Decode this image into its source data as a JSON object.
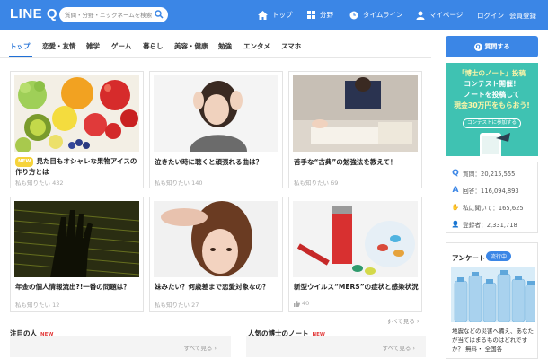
{
  "header": {
    "logo": "LINE Q",
    "search_placeholder": "質問・分野・ニックネームを検索",
    "nav": [
      {
        "label": "トップ",
        "icon": "home-icon"
      },
      {
        "label": "分野",
        "icon": "grid-icon"
      },
      {
        "label": "タイムライン",
        "icon": "clock-icon"
      },
      {
        "label": "マイページ",
        "icon": "person-icon"
      }
    ],
    "login": "ログイン",
    "register": "会員登録",
    "bg_color": "#3b86e6"
  },
  "tabs": [
    "トップ",
    "恋愛・友情",
    "雑学",
    "ゲーム",
    "暮らし",
    "美容・健康",
    "勉強",
    "エンタメ",
    "スマホ"
  ],
  "cards": [
    {
      "badge": "NEW",
      "title": "見た目もオシャレな果物アイスの作り方とは",
      "meta": "私も知りたい 432"
    },
    {
      "badge": "",
      "title": "泣きたい時に聴くと頑張れる曲は？",
      "meta": "私も知りたい 140"
    },
    {
      "badge": "",
      "title": "苦手な“古典”の勉強法を教えて！",
      "meta": "私も知りたい 69"
    },
    {
      "badge": "",
      "title": "年金の個人情報流出?!一番の問題は？",
      "meta": "私も知りたい 12"
    },
    {
      "badge": "",
      "title": "妹みたい？何歳差まで恋愛対象なの？",
      "meta": "私も知りたい 27"
    },
    {
      "badge": "",
      "title": "新型ウイルス“MERS”の症状と感染状況",
      "meta": "40"
    }
  ],
  "see_all": "すべて見る",
  "sections": {
    "notable": {
      "title": "注目の人",
      "badge": "NEW",
      "more": "すべて見る"
    },
    "hakase": {
      "title": "人気の博士のノート",
      "badge": "NEW",
      "more": "すべて見る"
    }
  },
  "sidebar": {
    "ask_button": "質問する",
    "ad": {
      "line1": "「博士のノート」投稿",
      "line2": "コンテスト開催！",
      "line3": "ノートを投稿して",
      "line4": "現金30万円をもらおう!",
      "cta": "コンテストに参加する"
    },
    "stats": [
      {
        "icon": "q-icon",
        "glyph": "Q",
        "label": "質問：20,215,555"
      },
      {
        "icon": "a-icon",
        "glyph": "A",
        "label": "回答：116,094,893"
      },
      {
        "icon": "hand-icon",
        "glyph": "✋",
        "label": "私に聞いて：165,625"
      },
      {
        "icon": "user-icon",
        "glyph": "👤",
        "label": "登録者：2,331,718"
      }
    ],
    "enquete": {
      "title": "アンケート",
      "live": "流行中",
      "text": "地震などの災害へ備え、あなたが当てはまるものはどれですか？ 無料・ 全国各"
    }
  }
}
